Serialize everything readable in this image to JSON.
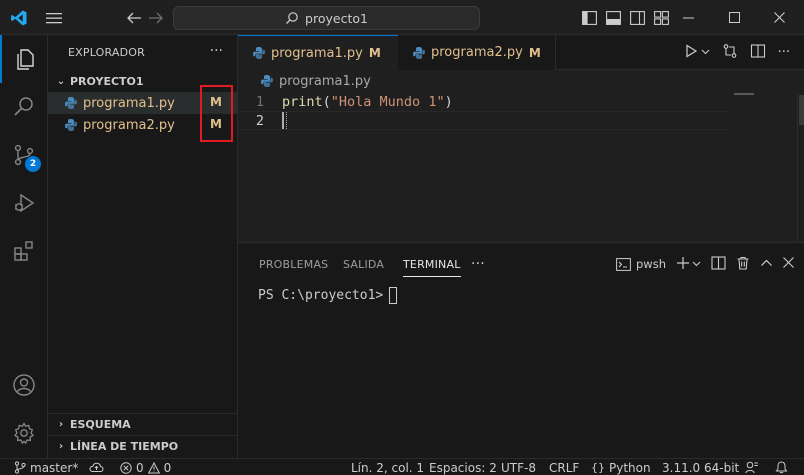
{
  "titlebar": {
    "search_text": "proyecto1",
    "icons": [
      "vscode-logo",
      "menu-icon",
      "arrow-left-icon",
      "arrow-right-icon",
      "search-icon",
      "toggle-sidebar-icon",
      "toggle-panel-icon",
      "toggle-secondary-sidebar-icon",
      "customize-layout-icon",
      "minimize-icon",
      "maximize-icon",
      "close-icon"
    ]
  },
  "activitybar": {
    "items": [
      "explorer-icon",
      "search-icon",
      "source-control-icon",
      "run-debug-icon",
      "extensions-icon",
      "accounts-icon",
      "settings-gear-icon"
    ],
    "scm_badge": "2"
  },
  "sidebar": {
    "title": "EXPLORADOR",
    "folder": "PROYECTO1",
    "files": [
      {
        "name": "programa1.py",
        "status": "M"
      },
      {
        "name": "programa2.py",
        "status": "M"
      }
    ],
    "outline": "ESQUEMA",
    "timeline": "LÍNEA DE TIEMPO"
  },
  "tabs": [
    {
      "name": "programa1.py",
      "status": "M"
    },
    {
      "name": "programa2.py",
      "status": "M"
    }
  ],
  "breadcrumb": "programa1.py",
  "editor": {
    "lines": [
      {
        "number": "1",
        "fn": "print",
        "open": "(",
        "string": "\"Hola Mundo 1\"",
        "close": ")"
      },
      {
        "number": "2"
      }
    ]
  },
  "panel": {
    "tabs": [
      "PROBLEMAS",
      "SALIDA",
      "TERMINAL"
    ],
    "active_tab": "TERMINAL",
    "shell": "pwsh",
    "prompt": "PS C:\\proyecto1>"
  },
  "statusbar": {
    "branch": "master*",
    "errors": "0",
    "warnings": "0",
    "position": "Lín. 2, col. 1",
    "spaces": "Espacios: 2",
    "encoding": "UTF-8",
    "eol": "CRLF",
    "language": "Python",
    "interpreter": "3.11.0 64-bit"
  },
  "colors": {
    "accent": "#0078d4",
    "modified": "#e2c08d",
    "highlight_box": "#e01b24"
  }
}
